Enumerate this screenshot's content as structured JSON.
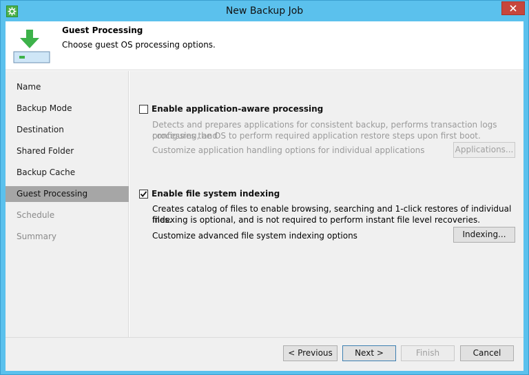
{
  "window": {
    "title": "New Backup Job",
    "app_icon": "veeam-gear-icon",
    "close_icon": "close-icon"
  },
  "header": {
    "title": "Guest Processing",
    "subtitle": "Choose guest OS processing options.",
    "icon": "download-arrow-drive-icon"
  },
  "sidebar": {
    "items": [
      {
        "label": "Name",
        "state": "normal"
      },
      {
        "label": "Backup Mode",
        "state": "normal"
      },
      {
        "label": "Destination",
        "state": "normal"
      },
      {
        "label": "Shared Folder",
        "state": "normal"
      },
      {
        "label": "Backup Cache",
        "state": "normal"
      },
      {
        "label": "Guest Processing",
        "state": "active"
      },
      {
        "label": "Schedule",
        "state": "disabled"
      },
      {
        "label": "Summary",
        "state": "disabled"
      }
    ]
  },
  "app_aware": {
    "checked": false,
    "label": "Enable application-aware processing",
    "description_line1": "Detects and prepares applications for consistent backup, performs transaction logs processing, and",
    "description_line2": "configures the OS to perform required application restore steps upon first boot.",
    "customize_text": "Customize application handling options for individual applications",
    "button_label": "Applications..."
  },
  "indexing": {
    "checked": true,
    "label": "Enable file system indexing",
    "description_line1": "Creates catalog of files to enable browsing, searching and 1-click restores of individual files.",
    "description_line2": "Indexing is optional, and is not required to perform instant file level recoveries.",
    "customize_text": "Customize advanced file system indexing options",
    "button_label": "Indexing..."
  },
  "footer": {
    "previous_label": "< Previous",
    "next_label": "Next >",
    "finish_label": "Finish",
    "cancel_label": "Cancel"
  },
  "colors": {
    "titlebar": "#5bc1ed",
    "close_button": "#c7463c",
    "active_nav": "#a6a6a6",
    "panel": "#f0f0f0"
  }
}
